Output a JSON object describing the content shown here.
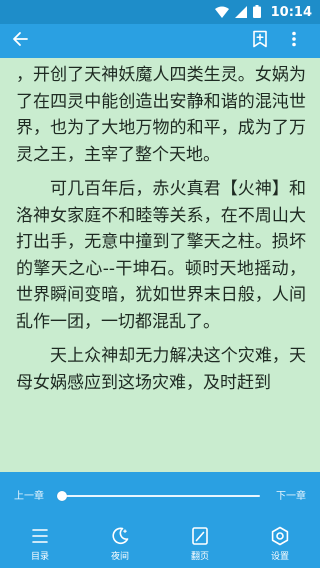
{
  "status_bar": {
    "time": "10:14"
  },
  "toolbar": {
    "back_icon": "arrow-left-icon",
    "bookmark_icon": "bookmark-add-icon",
    "more_icon": "more-vertical-icon"
  },
  "content": {
    "paragraphs": [
      "，开创了天神妖魔人四类生灵。女娲为了在四灵中能创造出安静和谐的混沌世界，也为了大地万物的和平，成为了万灵之王，主宰了整个天地。",
      "可几百年后，赤火真君【火神】和洛神女家庭不和睦等关系，在不周山大打出手，无意中撞到了擎天之柱。损坏的擎天之心--干坤石。顿时天地摇动，世界瞬间变暗，犹如世界末日般，人间乱作一团，一切都混乱了。",
      "天上众神却无力解决这个灾难，天母女娲感应到这场灾难，及时赶到"
    ]
  },
  "progress": {
    "prev_label": "上一章",
    "next_label": "下一章",
    "value": 0.01
  },
  "menu": {
    "items": [
      {
        "label": "目录",
        "icon": "list-icon"
      },
      {
        "label": "夜间",
        "icon": "moon-icon"
      },
      {
        "label": "翻页",
        "icon": "page-edit-icon"
      },
      {
        "label": "设置",
        "icon": "gear-icon"
      }
    ]
  },
  "colors": {
    "status_bar": "#1e8dc9",
    "toolbar": "#2aa0e2",
    "page_background": "#c9eccf",
    "text": "#1e2a22"
  }
}
